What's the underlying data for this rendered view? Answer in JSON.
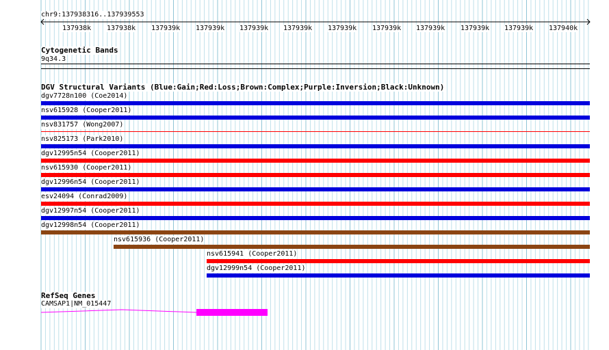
{
  "ruler": {
    "location": "chr9:137938316..137939553",
    "ticks": [
      "137938k",
      "137938k",
      "137939k",
      "137939k",
      "137939k",
      "137939k",
      "137939k",
      "137939k",
      "137939k",
      "137939k",
      "137939k",
      "137940k"
    ]
  },
  "cytobands": {
    "title": "Cytogenetic Bands",
    "band": "9q34.3"
  },
  "dgv": {
    "title": "DGV Structural Variants (Blue:Gain;Red:Loss;Brown:Complex;Purple:Inversion;Black:Unknown)",
    "colors": {
      "gain": "#0000dd",
      "loss": "#ff0000",
      "complex": "#8b4513"
    },
    "features": [
      {
        "label": "dgv7728n100 (Coe2014)",
        "type": "gain"
      },
      {
        "label": "nsv615928 (Cooper2011)",
        "type": "gain"
      },
      {
        "label": "nsv831757 (Wong2007)",
        "type": "loss"
      },
      {
        "label": "nsv825173 (Park2010)",
        "type": "gain"
      },
      {
        "label": "dgv12995n54 (Cooper2011)",
        "type": "loss"
      },
      {
        "label": "nsv615930 (Cooper2011)",
        "type": "loss"
      },
      {
        "label": "dgv12996n54 (Cooper2011)",
        "type": "gain"
      },
      {
        "label": "esv24094 (Conrad2009)",
        "type": "loss"
      },
      {
        "label": "dgv12997n54 (Cooper2011)",
        "type": "gain"
      },
      {
        "label": "dgv12998n54 (Cooper2011)",
        "type": "complex"
      },
      {
        "label": "nsv615936 (Cooper2011)",
        "type": "complex"
      },
      {
        "label": "nsv615941 (Cooper2011)",
        "type": "loss"
      },
      {
        "label": "dgv12999n54 (Cooper2011)",
        "type": "gain"
      }
    ]
  },
  "refseq": {
    "title": "RefSeq Genes",
    "gene": "CAMSAP1|NM_015447",
    "color": "#ff00ff"
  }
}
